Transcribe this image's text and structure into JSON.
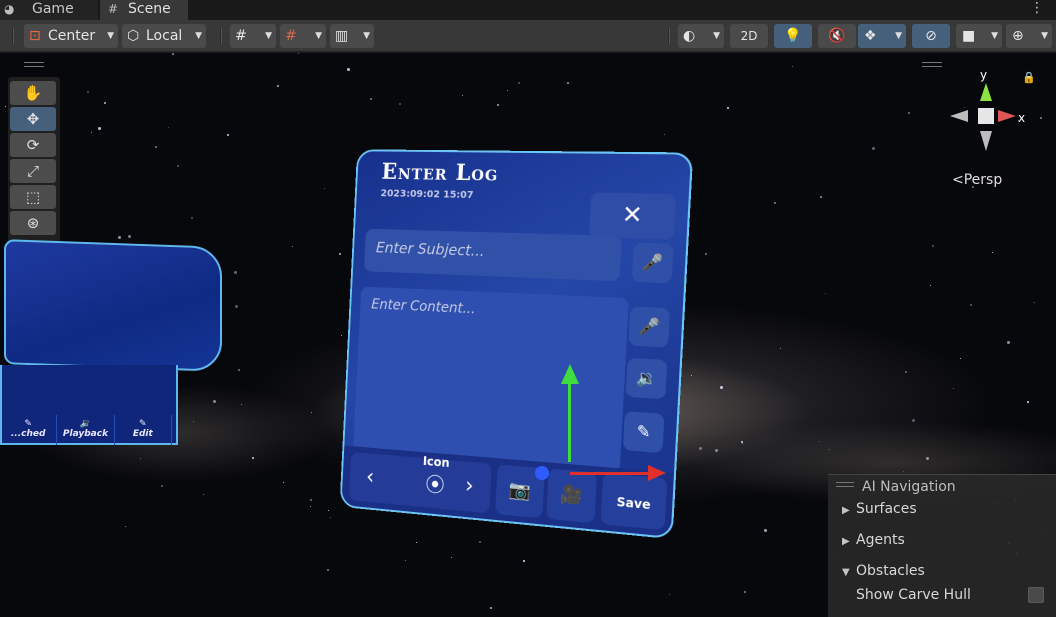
{
  "tabs": [
    {
      "label": "Game",
      "icon": "gamepad-icon"
    },
    {
      "label": "Scene",
      "icon": "hash-grid-icon"
    }
  ],
  "toolbar": {
    "pivot_mode": "Center",
    "pivot_rotation": "Local",
    "mode_2d": "2D"
  },
  "viewport": {
    "gizmo_axes": {
      "y": "y",
      "x": "x"
    },
    "projection": "Persp"
  },
  "log_panel": {
    "title": "Enter Log",
    "date": "2023:09:02 15:07",
    "close_glyph": "✕",
    "subject_placeholder": "Enter Subject...",
    "content_placeholder": "Enter Content...",
    "icon_label": "Icon",
    "save_label": "Save"
  },
  "side_window": {
    "bar_labels": [
      "...ched",
      "Playback",
      "Edit"
    ]
  },
  "ai_navigation": {
    "title": "AI Navigation",
    "sections": [
      {
        "label": "Surfaces",
        "expanded": false
      },
      {
        "label": "Agents",
        "expanded": false
      },
      {
        "label": "Obstacles",
        "expanded": true
      }
    ],
    "show_carve_hull_label": "Show Carve Hull",
    "show_carve_hull_checked": false
  },
  "colors": {
    "selected_tool": "#46607c",
    "panel_border": "#6cc4f5",
    "gizmo_x": "#e0302c",
    "gizmo_y": "#3fdc3f",
    "gizmo_z": "#2f5cff"
  }
}
